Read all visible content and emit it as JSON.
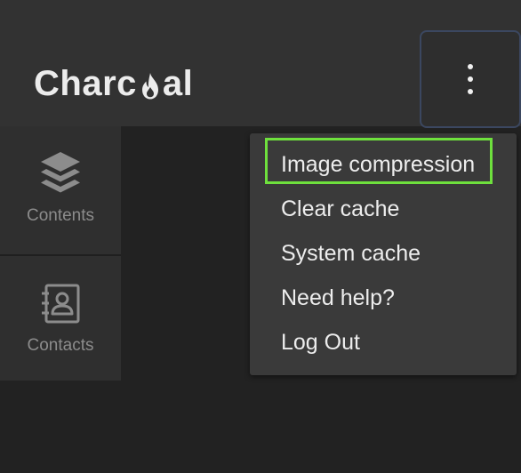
{
  "app": {
    "logo_text_left": "Charc",
    "logo_text_right": "al",
    "logo_color": "#ececec"
  },
  "header": {
    "menu_button_icon": "vertical-dots-icon"
  },
  "sidebar": {
    "items": [
      {
        "label": "Contents",
        "icon": "layers-icon"
      },
      {
        "label": "Contacts",
        "icon": "contact-book-icon"
      }
    ]
  },
  "dropdown": {
    "items": [
      {
        "label": "Image compression",
        "highlighted": true
      },
      {
        "label": "Clear cache"
      },
      {
        "label": "System cache"
      },
      {
        "label": "Need help?"
      },
      {
        "label": "Log Out"
      }
    ],
    "highlight_color": "#6ee03d"
  },
  "colors": {
    "background": "#222222",
    "topbar": "#323232",
    "sidebar_item": "#2f2f2f",
    "dropdown": "#3a3a3a",
    "menu_button_border": "#3b4760"
  }
}
